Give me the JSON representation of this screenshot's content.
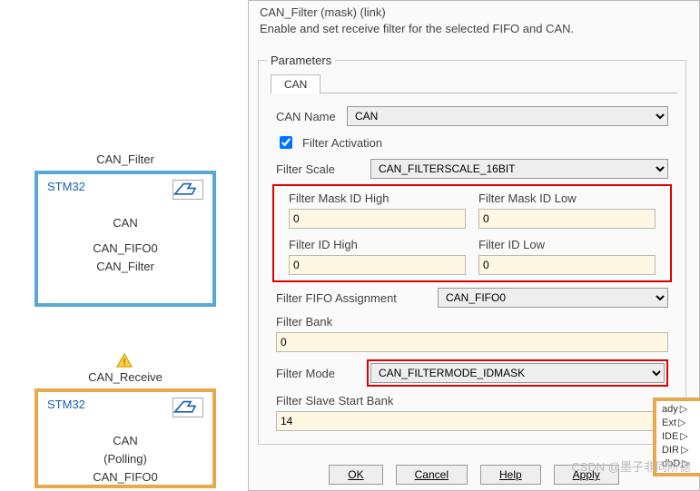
{
  "left_blocks": {
    "filter_title": "CAN_Filter",
    "receive_title": "CAN_Receive",
    "stm32": "STM32",
    "can_filter_lines": [
      "CAN",
      "CAN_FIFO0",
      "CAN_Filter"
    ],
    "can_receive_lines": [
      "CAN",
      "(Polling)",
      "CAN_FIFO0"
    ]
  },
  "desc": {
    "line1": "CAN_Filter (mask) (link)",
    "line2": "Enable and set receive filter for the selected FIFO and CAN."
  },
  "params": {
    "legend": "Parameters",
    "tab": "CAN",
    "can_name_lbl": "CAN Name",
    "can_name_val": "CAN",
    "filter_activation_lbl": "Filter Activation",
    "filter_activation_checked": true,
    "filter_scale_lbl": "Filter Scale",
    "filter_scale_val": "CAN_FILTERSCALE_16BIT",
    "mask_high_lbl": "Filter Mask ID High",
    "mask_high_val": "0",
    "mask_low_lbl": "Filter Mask ID Low",
    "mask_low_val": "0",
    "id_high_lbl": "Filter ID High",
    "id_high_val": "0",
    "id_low_lbl": "Filter ID Low",
    "id_low_val": "0",
    "fifo_lbl": "Filter FIFO Assignment",
    "fifo_val": "CAN_FIFO0",
    "bank_lbl": "Filter Bank",
    "bank_val": "0",
    "mode_lbl": "Filter Mode",
    "mode_val": "CAN_FILTERMODE_IDMASK",
    "slave_bank_lbl": "Filter Slave Start Bank",
    "slave_bank_val": "14"
  },
  "buttons": {
    "ok": "OK",
    "cancel": "Cancel",
    "help": "Help",
    "apply": "Apply"
  },
  "right_frag": {
    "l1": "ady",
    "l2": "Ext",
    "l3": "IDE",
    "l4": "DIR",
    "l5": "dbD"
  },
  "watermark": "CSDN @墨子非同阶德"
}
